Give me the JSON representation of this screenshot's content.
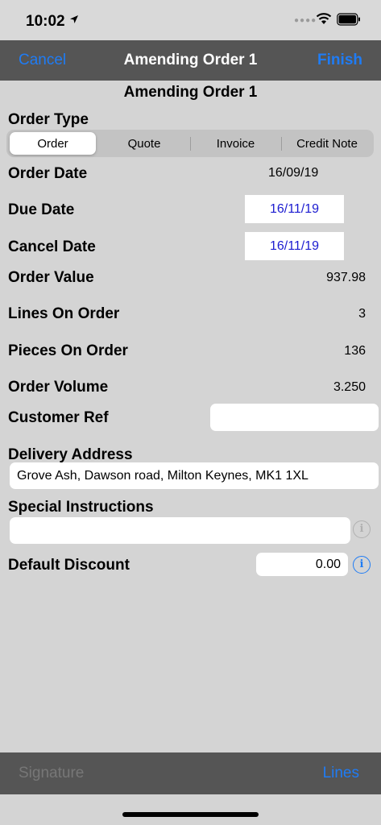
{
  "status_bar": {
    "time": "10:02",
    "location_icon": "location-arrow-icon"
  },
  "nav": {
    "cancel": "Cancel",
    "title": "Amending Order 1",
    "finish": "Finish"
  },
  "subtitle": "Amending Order 1",
  "order_type": {
    "label": "Order Type",
    "options": [
      "Order",
      "Quote",
      "Invoice",
      "Credit Note"
    ],
    "selected": "Order"
  },
  "fields": {
    "order_date": {
      "label": "Order Date",
      "value": "16/09/19"
    },
    "due_date": {
      "label": "Due Date",
      "value": "16/11/19"
    },
    "cancel_date": {
      "label": "Cancel Date",
      "value": "16/11/19"
    },
    "order_value": {
      "label": "Order Value",
      "value": "937.98"
    },
    "lines_on_order": {
      "label": "Lines On Order",
      "value": "3"
    },
    "pieces_on_order": {
      "label": "Pieces On Order",
      "value": "136"
    },
    "order_volume": {
      "label": "Order Volume",
      "value": "3.250"
    },
    "customer_ref": {
      "label": "Customer Ref",
      "value": ""
    },
    "delivery_address": {
      "label": "Delivery Address",
      "value": "Grove Ash, Dawson road, Milton Keynes, MK1 1XL"
    },
    "special_instructions": {
      "label": "Special Instructions",
      "value": ""
    },
    "default_discount": {
      "label": "Default Discount",
      "value": "0.00"
    }
  },
  "bottom_bar": {
    "signature": "Signature",
    "lines": "Lines"
  },
  "colors": {
    "accent": "#1f7cf5",
    "date_text": "#1b1bd0",
    "bar": "#555555",
    "background": "#d4d4d4"
  }
}
